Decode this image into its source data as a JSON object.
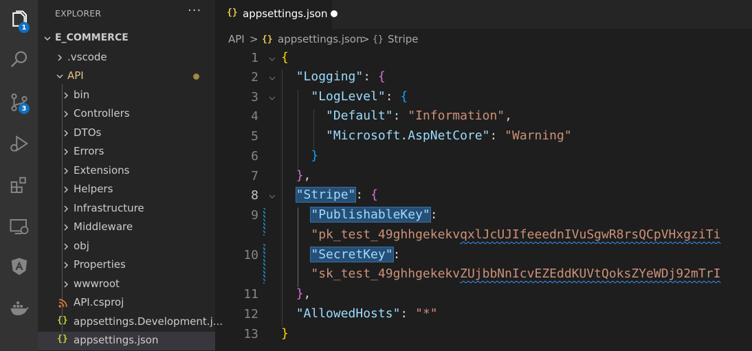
{
  "activity_bar": {
    "items": [
      {
        "icon": "files-icon",
        "badge": "1"
      },
      {
        "icon": "search-icon"
      },
      {
        "icon": "source-control-icon",
        "badge": "3"
      },
      {
        "icon": "run-debug-icon"
      },
      {
        "icon": "extensions-icon"
      },
      {
        "icon": "remote-explorer-icon"
      },
      {
        "icon": "angular-icon"
      },
      {
        "icon": "docker-icon"
      }
    ]
  },
  "explorer": {
    "title": "EXPLORER",
    "more": "···",
    "root": "E_COMMERCE",
    "items": [
      {
        "label": ".vscode"
      },
      {
        "label": "API"
      },
      {
        "label": "bin"
      },
      {
        "label": "Controllers"
      },
      {
        "label": "DTOs"
      },
      {
        "label": "Errors"
      },
      {
        "label": "Extensions"
      },
      {
        "label": "Helpers"
      },
      {
        "label": "Infrastructure"
      },
      {
        "label": "Middleware"
      },
      {
        "label": "obj"
      },
      {
        "label": "Properties"
      },
      {
        "label": "wwwroot"
      },
      {
        "label": "API.csproj",
        "icon": "rss"
      },
      {
        "label": "appsettings.Development.j...",
        "icon": "{}"
      },
      {
        "label": "appsettings.json",
        "icon": "{}"
      }
    ]
  },
  "tab": {
    "icon": "{}",
    "label": "appsettings.json"
  },
  "breadcrumb": {
    "root": "API",
    "sep": ">",
    "file_icon": "{}",
    "file": "appsettings.json",
    "node_icon": "{}",
    "node": "Stripe"
  },
  "editor": {
    "line_numbers": [
      "1",
      "2",
      "3",
      "4",
      "5",
      "6",
      "7",
      "8",
      "9",
      "",
      "10",
      "",
      "11",
      "12",
      "13",
      ""
    ],
    "tokens": {
      "l1_open": "{",
      "l2_key": "\"Logging\"",
      "colon": ":",
      "l2_open": "{",
      "l3_key": "\"LogLevel\"",
      "l3_open": "{",
      "l4_key": "\"Default\"",
      "l4_val": "\"Information\"",
      "comma": ",",
      "l5_key": "\"Microsoft.AspNetCore\"",
      "l5_val": "\"Warning\"",
      "l6_close": "}",
      "l7_close": "}",
      "l8_key": "\"Stripe\"",
      "l8_open": "{",
      "l9_key": "\"PublishableKey\"",
      "l9_val_a": "\"pk_test_49ghhgekekv",
      "l9_val_b": "qxlJcUJIfeeednIVuSgwR8rsQCpVHxgziTi",
      "l10_key": "\"SecretKey\"",
      "l10_val_a": "\"sk_test_49ghhgekekv",
      "l10_val_b": "ZUjbbNnIcvEZEddKUVtQoksZYeWDj92mTrI",
      "l11_close": "}",
      "l12_key": "\"AllowedHosts\"",
      "l12_val": "\"*\"",
      "l13_close": "}"
    }
  }
}
